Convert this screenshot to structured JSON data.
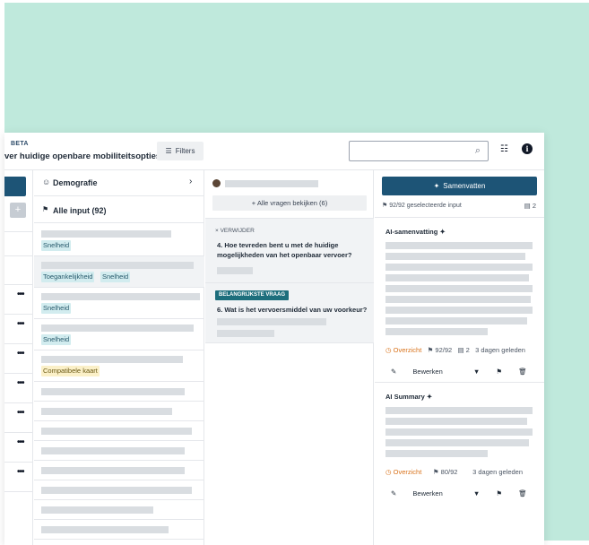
{
  "header": {
    "beta": "BETA",
    "title": "ver huidige openbare mobiliteitsopties",
    "filters_label": "Filters",
    "search_placeholder": ""
  },
  "left_rail": {
    "add": "+",
    "more": "•••"
  },
  "input_list": {
    "demografie": "Demografie",
    "all_input": "Alle input (92)",
    "items": [
      {
        "tags": [
          "Snelheid"
        ]
      },
      {
        "tags": [
          "Toegankelijkheid",
          "Snelheid"
        ]
      },
      {
        "tags": [
          "Snelheid"
        ]
      },
      {
        "tags": [
          "Snelheid"
        ]
      },
      {
        "tags": [
          "Compatibele kaart"
        ]
      }
    ]
  },
  "questions": {
    "view_all": "+ Alle vragen bekijken (6)",
    "q1_remove": "× VERWIJDER",
    "q1_text": "4. Hoe tevreden bent u met de huidige mogelijkheden van het openbaar vervoer?",
    "q2_badge": "BELANGRIJKSTE VRAAG",
    "q2_text": "6. Wat is het vervoersmiddel van uw voorkeur?"
  },
  "summary": {
    "button": "Samenvatten",
    "selected_input": "92/92 geselecteerde input",
    "selected_count": "2",
    "sections": [
      {
        "title": "AI-samenvatting",
        "overview": "Overzicht",
        "count": "92/92",
        "docs": "2",
        "time": "3 dagen geleden",
        "edit": "Bewerken"
      },
      {
        "title": "AI Summary",
        "overview": "Overzicht",
        "count": "80/92",
        "time": "3 dagen geleden",
        "edit": "Bewerken"
      }
    ]
  }
}
